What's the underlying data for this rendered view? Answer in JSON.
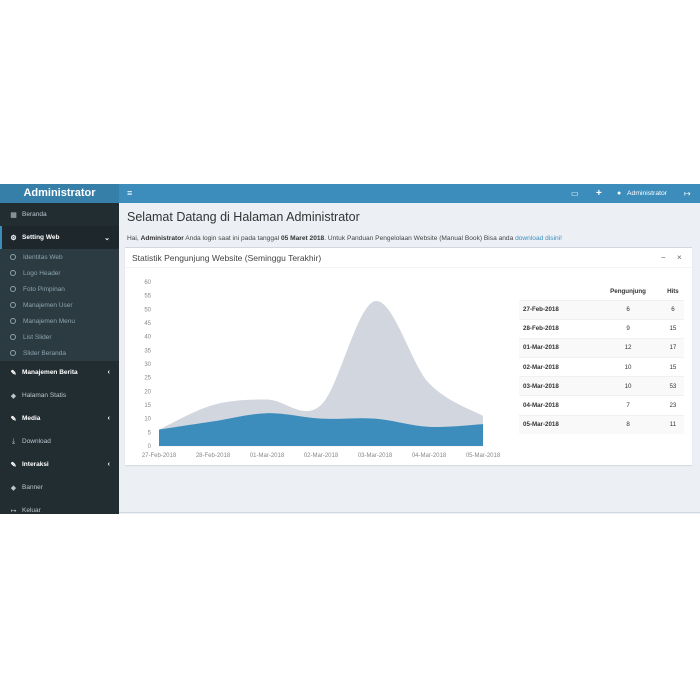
{
  "sidebar": {
    "brand": "Administrator",
    "items": [
      {
        "label": "Beranda",
        "icon": "dashboard-icon"
      },
      {
        "label": "Setting Web",
        "icon": "gear-icon",
        "active": true
      },
      {
        "label": "Identitas Web"
      },
      {
        "label": "Logo Header"
      },
      {
        "label": "Foto Pimpinan"
      },
      {
        "label": "Manajemen User"
      },
      {
        "label": "Manajemen Menu"
      },
      {
        "label": "List Slider"
      },
      {
        "label": "Slider Beranda"
      },
      {
        "label": "Manajemen Berita",
        "icon": "edit-icon"
      },
      {
        "label": "Halaman Statis",
        "icon": "tag-icon"
      },
      {
        "label": "Media",
        "icon": "edit-icon"
      },
      {
        "label": "Download",
        "icon": "download-icon"
      },
      {
        "label": "Interaksi",
        "icon": "edit-icon"
      },
      {
        "label": "Banner",
        "icon": "tag-icon"
      },
      {
        "label": "Keluar",
        "icon": "logout-icon"
      }
    ]
  },
  "topbar": {
    "menu_icon": "≡",
    "user_name": "Administrator",
    "icons": [
      "laptop-icon",
      "plus-icon",
      "user-icon",
      "logout-icon"
    ]
  },
  "main": {
    "title": "Selamat Datang di Halaman Administrator",
    "welcome": {
      "greeting": "Hai, ",
      "user": "Administrator",
      "text1": " Anda login saat ini pada tanggal ",
      "date": "05 Maret 2018",
      "text2": ". Untuk Panduan Pengelolaan Website (Manual Book) Bisa anda ",
      "link": "download disini!"
    }
  },
  "box": {
    "title": "Statistik Pengunjung Website (Seminggu Terakhir)",
    "minimize": "−",
    "close": "×"
  },
  "chart_data": {
    "type": "area",
    "x": [
      "27-Feb-2018",
      "28-Feb-2018",
      "01-Mar-2018",
      "02-Mar-2018",
      "03-Mar-2018",
      "04-Mar-2018",
      "05-Mar-2018"
    ],
    "series": [
      {
        "name": "Hits",
        "values": [
          6,
          15,
          17,
          15,
          53,
          23,
          11
        ],
        "color": "#d2d6de"
      },
      {
        "name": "Pengunjung",
        "values": [
          6,
          9,
          12,
          10,
          10,
          7,
          8
        ],
        "color": "#3c8dbc"
      }
    ],
    "ylim": [
      0,
      60
    ],
    "yticks": [
      0,
      5,
      10,
      15,
      20,
      25,
      30,
      35,
      40,
      45,
      50,
      55,
      60
    ]
  },
  "table": {
    "headers": [
      "",
      "Pengunjung",
      "Hits"
    ],
    "rows": [
      {
        "date": "27-Feb-2018",
        "pengunjung": "6",
        "hits": "6"
      },
      {
        "date": "28-Feb-2018",
        "pengunjung": "9",
        "hits": "15"
      },
      {
        "date": "01-Mar-2018",
        "pengunjung": "12",
        "hits": "17"
      },
      {
        "date": "02-Mar-2018",
        "pengunjung": "10",
        "hits": "15"
      },
      {
        "date": "03-Mar-2018",
        "pengunjung": "10",
        "hits": "53"
      },
      {
        "date": "04-Mar-2018",
        "pengunjung": "7",
        "hits": "23"
      },
      {
        "date": "05-Mar-2018",
        "pengunjung": "8",
        "hits": "11"
      }
    ]
  }
}
